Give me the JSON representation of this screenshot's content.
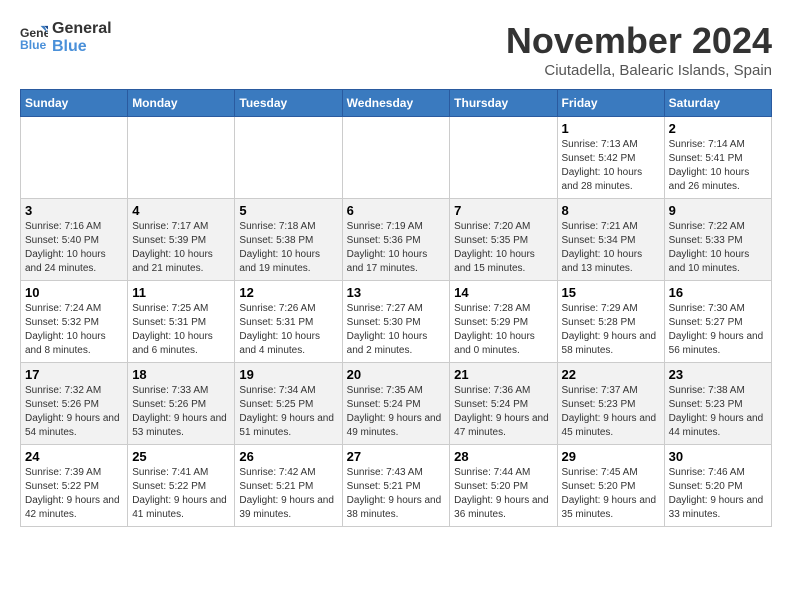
{
  "header": {
    "logo_general": "General",
    "logo_blue": "Blue",
    "month_title": "November 2024",
    "location": "Ciutadella, Balearic Islands, Spain"
  },
  "weekdays": [
    "Sunday",
    "Monday",
    "Tuesday",
    "Wednesday",
    "Thursday",
    "Friday",
    "Saturday"
  ],
  "weeks": [
    [
      {
        "day": "",
        "info": ""
      },
      {
        "day": "",
        "info": ""
      },
      {
        "day": "",
        "info": ""
      },
      {
        "day": "",
        "info": ""
      },
      {
        "day": "",
        "info": ""
      },
      {
        "day": "1",
        "info": "Sunrise: 7:13 AM\nSunset: 5:42 PM\nDaylight: 10 hours and 28 minutes."
      },
      {
        "day": "2",
        "info": "Sunrise: 7:14 AM\nSunset: 5:41 PM\nDaylight: 10 hours and 26 minutes."
      }
    ],
    [
      {
        "day": "3",
        "info": "Sunrise: 7:16 AM\nSunset: 5:40 PM\nDaylight: 10 hours and 24 minutes."
      },
      {
        "day": "4",
        "info": "Sunrise: 7:17 AM\nSunset: 5:39 PM\nDaylight: 10 hours and 21 minutes."
      },
      {
        "day": "5",
        "info": "Sunrise: 7:18 AM\nSunset: 5:38 PM\nDaylight: 10 hours and 19 minutes."
      },
      {
        "day": "6",
        "info": "Sunrise: 7:19 AM\nSunset: 5:36 PM\nDaylight: 10 hours and 17 minutes."
      },
      {
        "day": "7",
        "info": "Sunrise: 7:20 AM\nSunset: 5:35 PM\nDaylight: 10 hours and 15 minutes."
      },
      {
        "day": "8",
        "info": "Sunrise: 7:21 AM\nSunset: 5:34 PM\nDaylight: 10 hours and 13 minutes."
      },
      {
        "day": "9",
        "info": "Sunrise: 7:22 AM\nSunset: 5:33 PM\nDaylight: 10 hours and 10 minutes."
      }
    ],
    [
      {
        "day": "10",
        "info": "Sunrise: 7:24 AM\nSunset: 5:32 PM\nDaylight: 10 hours and 8 minutes."
      },
      {
        "day": "11",
        "info": "Sunrise: 7:25 AM\nSunset: 5:31 PM\nDaylight: 10 hours and 6 minutes."
      },
      {
        "day": "12",
        "info": "Sunrise: 7:26 AM\nSunset: 5:31 PM\nDaylight: 10 hours and 4 minutes."
      },
      {
        "day": "13",
        "info": "Sunrise: 7:27 AM\nSunset: 5:30 PM\nDaylight: 10 hours and 2 minutes."
      },
      {
        "day": "14",
        "info": "Sunrise: 7:28 AM\nSunset: 5:29 PM\nDaylight: 10 hours and 0 minutes."
      },
      {
        "day": "15",
        "info": "Sunrise: 7:29 AM\nSunset: 5:28 PM\nDaylight: 9 hours and 58 minutes."
      },
      {
        "day": "16",
        "info": "Sunrise: 7:30 AM\nSunset: 5:27 PM\nDaylight: 9 hours and 56 minutes."
      }
    ],
    [
      {
        "day": "17",
        "info": "Sunrise: 7:32 AM\nSunset: 5:26 PM\nDaylight: 9 hours and 54 minutes."
      },
      {
        "day": "18",
        "info": "Sunrise: 7:33 AM\nSunset: 5:26 PM\nDaylight: 9 hours and 53 minutes."
      },
      {
        "day": "19",
        "info": "Sunrise: 7:34 AM\nSunset: 5:25 PM\nDaylight: 9 hours and 51 minutes."
      },
      {
        "day": "20",
        "info": "Sunrise: 7:35 AM\nSunset: 5:24 PM\nDaylight: 9 hours and 49 minutes."
      },
      {
        "day": "21",
        "info": "Sunrise: 7:36 AM\nSunset: 5:24 PM\nDaylight: 9 hours and 47 minutes."
      },
      {
        "day": "22",
        "info": "Sunrise: 7:37 AM\nSunset: 5:23 PM\nDaylight: 9 hours and 45 minutes."
      },
      {
        "day": "23",
        "info": "Sunrise: 7:38 AM\nSunset: 5:23 PM\nDaylight: 9 hours and 44 minutes."
      }
    ],
    [
      {
        "day": "24",
        "info": "Sunrise: 7:39 AM\nSunset: 5:22 PM\nDaylight: 9 hours and 42 minutes."
      },
      {
        "day": "25",
        "info": "Sunrise: 7:41 AM\nSunset: 5:22 PM\nDaylight: 9 hours and 41 minutes."
      },
      {
        "day": "26",
        "info": "Sunrise: 7:42 AM\nSunset: 5:21 PM\nDaylight: 9 hours and 39 minutes."
      },
      {
        "day": "27",
        "info": "Sunrise: 7:43 AM\nSunset: 5:21 PM\nDaylight: 9 hours and 38 minutes."
      },
      {
        "day": "28",
        "info": "Sunrise: 7:44 AM\nSunset: 5:20 PM\nDaylight: 9 hours and 36 minutes."
      },
      {
        "day": "29",
        "info": "Sunrise: 7:45 AM\nSunset: 5:20 PM\nDaylight: 9 hours and 35 minutes."
      },
      {
        "day": "30",
        "info": "Sunrise: 7:46 AM\nSunset: 5:20 PM\nDaylight: 9 hours and 33 minutes."
      }
    ]
  ]
}
